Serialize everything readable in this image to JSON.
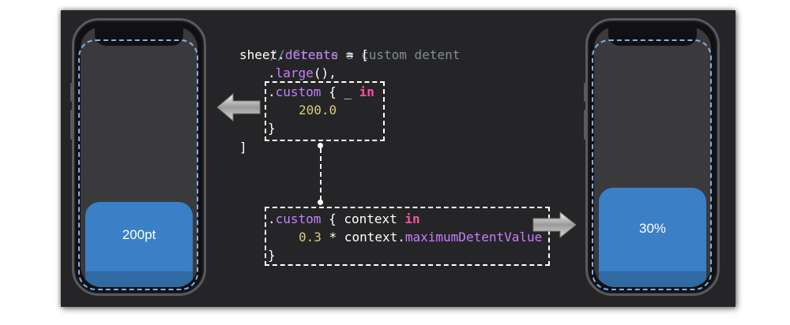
{
  "code": {
    "comment": "// Create a custom detent",
    "line_sheet": "sheet",
    "line_dot": ".",
    "line_detents": "detents",
    "line_assign": " = [",
    "large_dot": ".",
    "large_name": "large",
    "large_tail": "(),",
    "closing": "]",
    "custom1": {
      "dot": ".",
      "name": "custom",
      "brace_open": " { _ ",
      "in": "in",
      "value": "200.0",
      "brace_close": "}"
    },
    "custom2": {
      "dot": ".",
      "name": "custom",
      "brace_open": " { context ",
      "in": "in",
      "factor": "0.3",
      "times": " * context.",
      "max_value": "maximumDetentValue",
      "brace_close": "}"
    }
  },
  "left_phone": {
    "sheet_label": "200pt"
  },
  "right_phone": {
    "sheet_label": "30%"
  },
  "colors": {
    "background": "#252527",
    "sheet": "#3b7fc6",
    "keyword": "#ff4fa0",
    "property": "#c77dff",
    "number": "#d9c97c",
    "comment": "#7f8c98",
    "safe_area": "#7fb0e8"
  },
  "icons": [
    "arrow-left-icon",
    "arrow-right-icon"
  ]
}
